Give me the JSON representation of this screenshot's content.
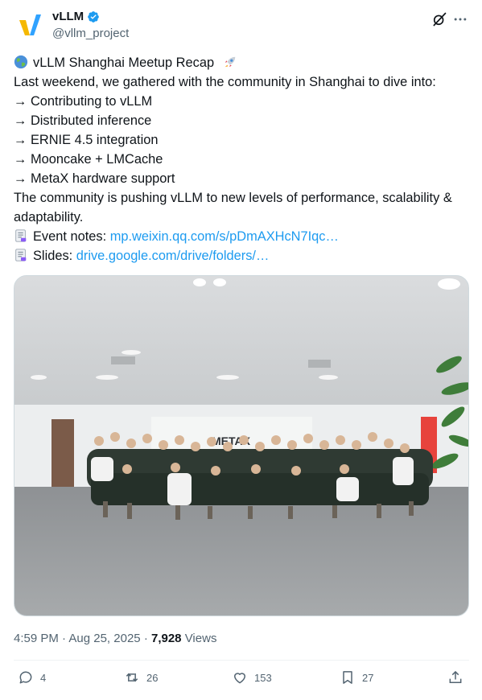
{
  "author": {
    "name": "vLLM",
    "handle": "@vllm_project",
    "verified": true
  },
  "post": {
    "title_line": "vLLM Shanghai Meetup Recap",
    "intro": "Last weekend, we gathered with the community in Shanghai to dive into:",
    "topics": [
      "→ Contributing to vLLM",
      "→ Distributed inference",
      "→ ERNIE 4.5 integration",
      "→ Mooncake + LMCache",
      "→ MetaX hardware support"
    ],
    "closing": "The community is pushing vLLM to new levels of performance, scalability & adaptability.",
    "event_notes_label": "Event notes:",
    "event_notes_link": "mp.weixin.qq.com/s/pDmAXHcN7Iqc…",
    "slides_label": "Slides:",
    "slides_link": "drive.google.com/drive/folders/…"
  },
  "meta": {
    "time": "4:59 PM",
    "separator1": "·",
    "date": "Aug 25, 2025",
    "separator2": "·",
    "views_count": "7,928",
    "views_label": "Views"
  },
  "actions": {
    "replies": "4",
    "reposts": "26",
    "likes": "153",
    "bookmarks": "27"
  },
  "colors": {
    "accent": "#1d9bf0",
    "muted": "#536471",
    "text": "#0f1419"
  },
  "icons": [
    "vllm-logo",
    "verified-badge-icon",
    "grok-icon",
    "more-icon",
    "globe-emoji",
    "rocket-emoji",
    "document-emoji",
    "reply-icon",
    "repost-icon",
    "like-icon",
    "bookmark-icon",
    "share-icon"
  ]
}
